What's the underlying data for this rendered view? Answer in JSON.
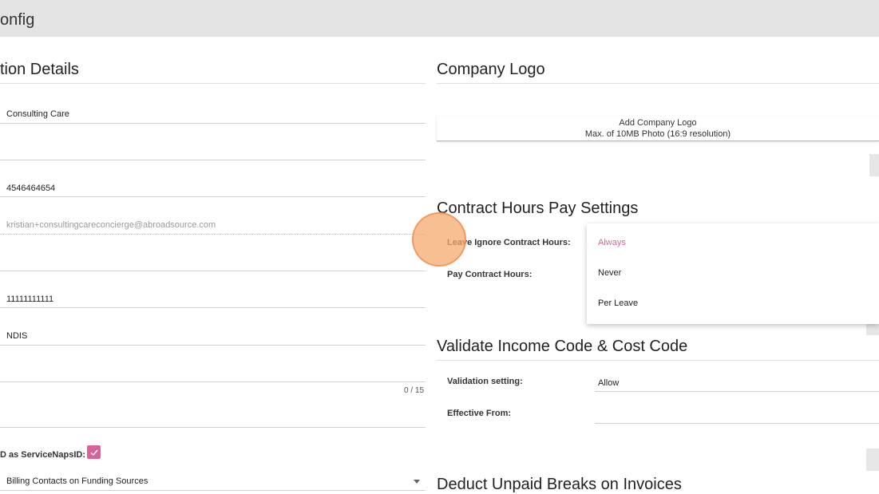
{
  "header": {
    "title": "onfig"
  },
  "left": {
    "section_title": "tion Details",
    "fields": {
      "name": "Consulting Care",
      "phone": "4546464654",
      "email_placeholder": "kristian+consultingcareconcierge@abroadsource.com",
      "number": "11111111111",
      "ndis": "NDIS",
      "counter": "0 / 15"
    },
    "checkbox_label": "D as ServiceNapsID:",
    "billing_select": "Billing Contacts on Funding Sources"
  },
  "right": {
    "logo": {
      "title": "Company Logo",
      "line1": "Add Company Logo",
      "line2": "Max. of 10MB Photo (16:9 resolution)"
    },
    "contract": {
      "title": "Contract Hours Pay Settings",
      "leave_label": "Leave Ignore Contract Hours:",
      "pay_label": "Pay Contract Hours:",
      "options": [
        "Always",
        "Never",
        "Per Leave"
      ]
    },
    "validate": {
      "title": "Validate Income Code & Cost Code",
      "setting_label": "Validation setting:",
      "setting_value": "Allow",
      "effective_label": "Effective From:"
    },
    "deduct": {
      "title": "Deduct Unpaid Breaks on Invoices"
    }
  },
  "colors": {
    "accent": "#d6649a",
    "highlight": "#f6aa6e"
  }
}
